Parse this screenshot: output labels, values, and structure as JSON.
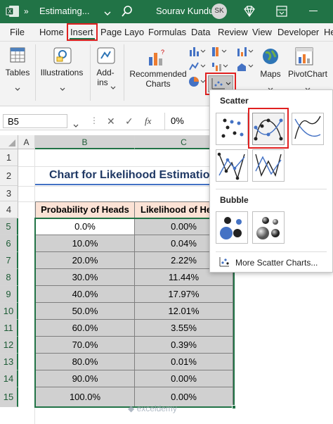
{
  "titlebar": {
    "doc_title": "Estimating...",
    "user_name": "Sourav Kundu",
    "user_initials": "SK",
    "color": "#217346"
  },
  "menu": {
    "tabs": [
      "File",
      "Home",
      "Insert",
      "Page Layo",
      "Formulas",
      "Data",
      "Review",
      "View",
      "Developer",
      "He"
    ],
    "active": "Insert"
  },
  "ribbon": {
    "tables": "Tables",
    "illustrations": "Illustrations",
    "addins_line1": "Add-",
    "addins_line2": "ins",
    "recommended_line1": "Recommended",
    "recommended_line2": "Charts",
    "maps": "Maps",
    "pivotchart": "PivotChart"
  },
  "formula_bar": {
    "name_box": "B5",
    "fx": "fx",
    "value": "0%"
  },
  "columns": [
    "A",
    "B",
    "C"
  ],
  "rows": [
    "1",
    "2",
    "3",
    "4",
    "5",
    "6",
    "7",
    "8",
    "9",
    "10",
    "11",
    "12",
    "13",
    "14",
    "15"
  ],
  "sheet": {
    "title": "Chart for Likelihood Estimatio",
    "header_b": "Probability of Heads",
    "header_c": "Likelihood of He",
    "data": [
      [
        "0.0%",
        "0.00%"
      ],
      [
        "10.0%",
        "0.04%"
      ],
      [
        "20.0%",
        "2.22%"
      ],
      [
        "30.0%",
        "11.44%"
      ],
      [
        "40.0%",
        "17.97%"
      ],
      [
        "50.0%",
        "12.01%"
      ],
      [
        "60.0%",
        "3.55%"
      ],
      [
        "70.0%",
        "0.39%"
      ],
      [
        "80.0%",
        "0.01%"
      ],
      [
        "90.0%",
        "0.00%"
      ],
      [
        "100.0%",
        "0.00%"
      ]
    ]
  },
  "scatter_menu": {
    "scatter_heading": "Scatter",
    "bubble_heading": "Bubble",
    "more_link": "More Scatter Charts..."
  },
  "watermark": "exceldemy"
}
